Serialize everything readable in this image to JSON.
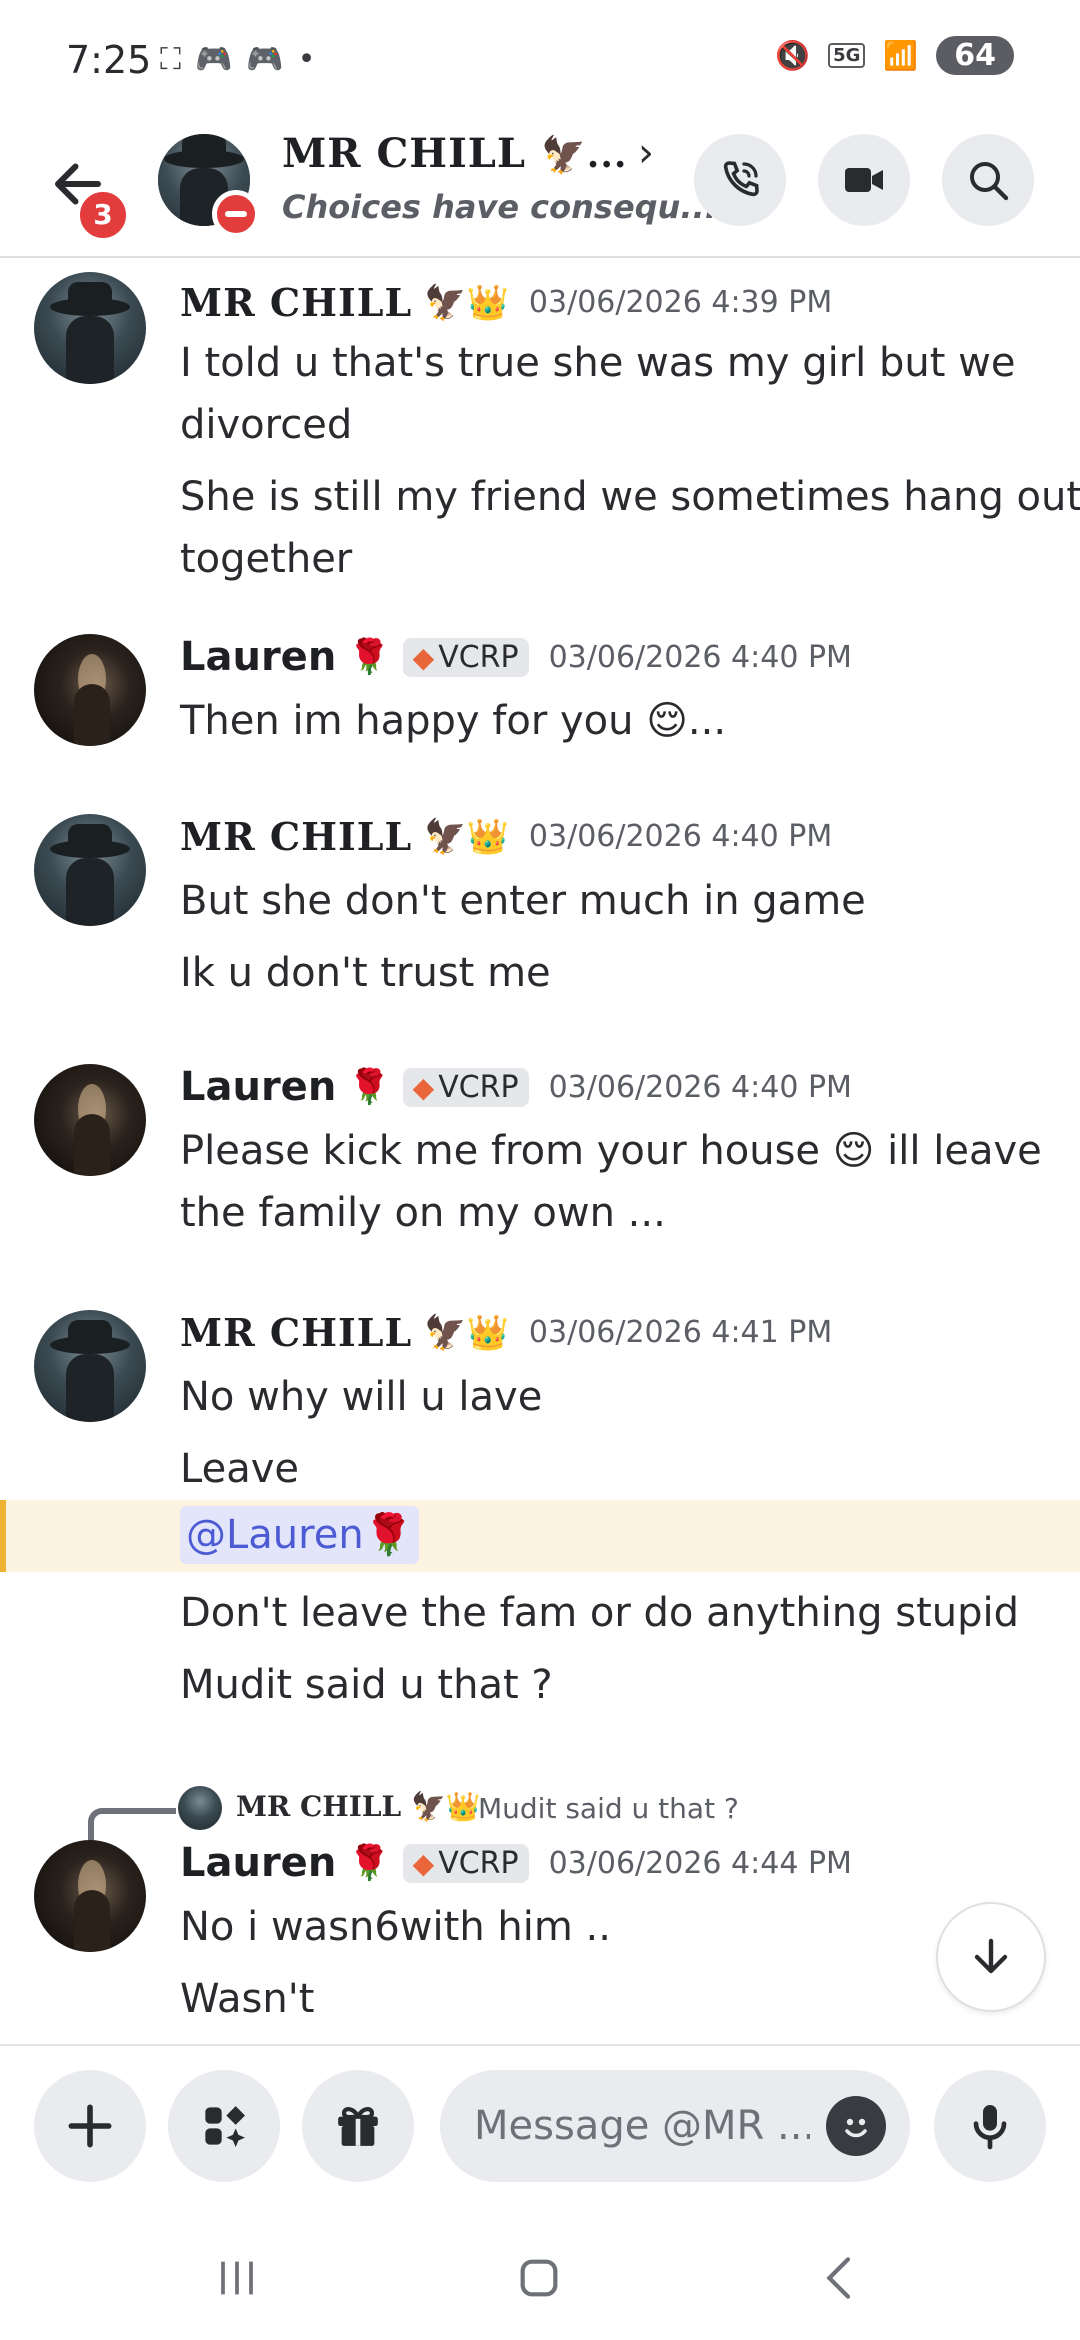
{
  "status_bar": {
    "time": "7:25",
    "left_icons": [
      "screenshot-icon",
      "discord-icon",
      "discord-icon",
      "dot-icon"
    ],
    "network": "5G",
    "battery": "64"
  },
  "header": {
    "notification_count": "3",
    "name": "MR CHILL",
    "name_emoji": "🦅...",
    "status": "Choices have consequ...",
    "actions": [
      "phone-icon",
      "video-icon",
      "search-icon"
    ]
  },
  "users": {
    "chill": {
      "name": "MR CHILL",
      "emojis": "🦅👑"
    },
    "lauren": {
      "name": "Lauren",
      "emoji": "🌹",
      "tag": "VCRP"
    }
  },
  "messages": [
    {
      "author": "MR CHILL",
      "time": "03/06/2026 4:39 PM",
      "lines": [
        "I told u that's true she was my girl but we",
        "divorced",
        "She is still my friend we sometimes hang out",
        "together"
      ]
    },
    {
      "author": "Lauren",
      "time": "03/06/2026 4:40 PM",
      "lines": [
        "Then im happy for you 😌..."
      ]
    },
    {
      "author": "MR CHILL",
      "time": "03/06/2026 4:40 PM",
      "lines": [
        "But she don't enter much in game",
        "Ik u don't trust me"
      ]
    },
    {
      "author": "Lauren",
      "time": "03/06/2026 4:40 PM",
      "lines": [
        "Please kick me from your house 😌 ill leave",
        "the family on my own ..."
      ]
    },
    {
      "author": "MR CHILL",
      "time": "03/06/2026 4:41 PM",
      "lines": [
        "No why will u lave",
        "Leave",
        "@Lauren🌹",
        "Don't leave the fam or do anything stupid",
        "Mudit said u that ?"
      ]
    },
    {
      "author": "Lauren",
      "time": "03/06/2026 4:44 PM",
      "reply": {
        "author": "MR CHILL",
        "author_emojis": "🦅👑",
        "text": "Mudit said u that ?"
      },
      "lines": [
        "No i wasn6with him ..",
        "Wasn't"
      ]
    }
  ],
  "composer": {
    "placeholder": "Message @MR ..."
  },
  "colors": {
    "mention_bg": "#fdf3e1",
    "mention_bar": "#f0b232",
    "mention_text": "#4c5bd4",
    "badge_red": "#e23c3c"
  }
}
